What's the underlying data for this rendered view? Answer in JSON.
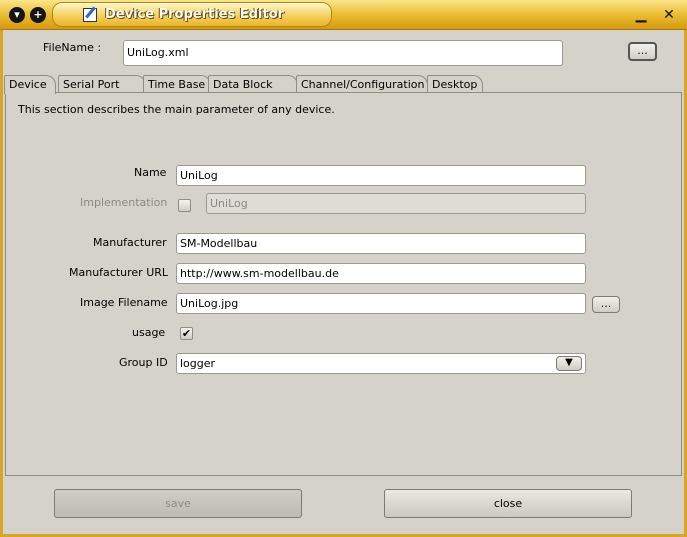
{
  "window": {
    "title": "Device Properties Editor",
    "icons": [
      "menu-icon",
      "plus-icon",
      "edit-icon",
      "minimize-icon",
      "close-icon"
    ]
  },
  "file": {
    "label": "FileName :",
    "value": "UniLog.xml",
    "browse_label": "..."
  },
  "tabs": [
    {
      "label": "Device",
      "active": true
    },
    {
      "label": "Serial Port"
    },
    {
      "label": "Time Base"
    },
    {
      "label": "Data Block"
    },
    {
      "label": "Channel/Configuration"
    },
    {
      "label": "Desktop"
    }
  ],
  "device": {
    "description": "This section describes the main parameter of any device.",
    "name_label": "Name",
    "name_value": "UniLog",
    "implementation_label": "Implementation",
    "implementation_value": "UniLog",
    "manufacturer_label": "Manufacturer",
    "manufacturer_value": "SM-Modellbau",
    "manufacturer_url_label": "Manufacturer URL",
    "manufacturer_url_value": "http://www.sm-modellbau.de",
    "image_filename_label": "Image Filename",
    "image_filename_value": "UniLog.jpg",
    "image_browse_label": "...",
    "usage_label": "usage",
    "usage_checked": "✔",
    "group_id_label": "Group ID",
    "group_id_value": "logger"
  },
  "buttons": {
    "save": "save",
    "close": "close"
  },
  "colors": {
    "titlebar": "#e9b92c",
    "background": "#d5d3c9"
  }
}
